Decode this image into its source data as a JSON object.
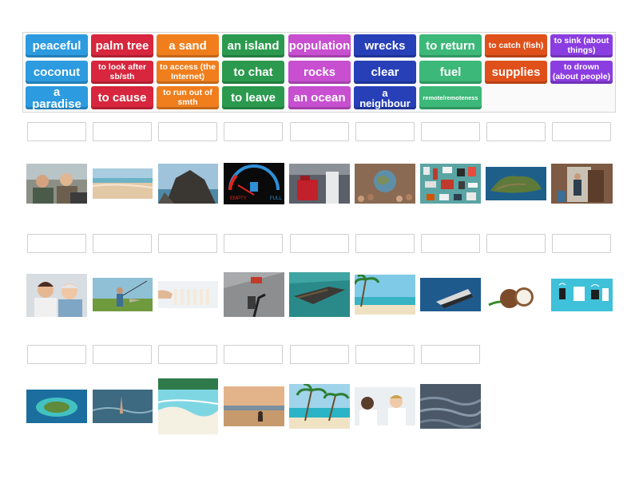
{
  "colors": {
    "blue": "#2d9be0",
    "red": "#d7263d",
    "orange": "#f07e1d",
    "green": "#2b9a4e",
    "pink": "#c74fd0",
    "navy": "#2740b8",
    "teal": "#3cb878",
    "deeporange": "#e0501a",
    "purple": "#8a3de0",
    "slot_border": "#cfcfcf"
  },
  "tiles": [
    [
      "peaceful",
      "palm tree",
      "a sand",
      "an island",
      "population",
      "wrecks",
      "to return",
      "to catch (fish)",
      "to sink (about things)"
    ],
    [
      "coconut",
      "to look after sb/sth",
      "to access (the Internet)",
      "to chat",
      "rocks",
      "clear",
      "fuel",
      "supplies",
      "to drown (about people)"
    ],
    [
      "a paradise",
      "to cause",
      "to run out of smth",
      "to leave",
      "an ocean",
      "a neighbour",
      "remote/remoteness"
    ]
  ],
  "images": [
    [
      "people-chatting-photo",
      "sandy-beach-photo",
      "coastal-rocks-photo",
      "fuel-gauge-photo",
      "fuel-canister-photo",
      "crowd-globe-photo",
      "supplies-flatlay-photo",
      "island-aerial-photo",
      "leaving-home-photo"
    ],
    [
      "caring-elderly-photo",
      "fishing-photo",
      "dominoes-photo",
      "internet-access-photo",
      "shipwreck-photo",
      "palm-beach-photo",
      "sinking-ship-photo",
      "coconut-photo",
      "connected-devices-photo"
    ],
    [
      "tropical-island-photo",
      "drowning-hand-photo",
      "clear-water-photo",
      "sunset-beach-photo",
      "paradise-beach-photo",
      "neighbours-talking-photo",
      "ocean-waves-photo"
    ]
  ]
}
